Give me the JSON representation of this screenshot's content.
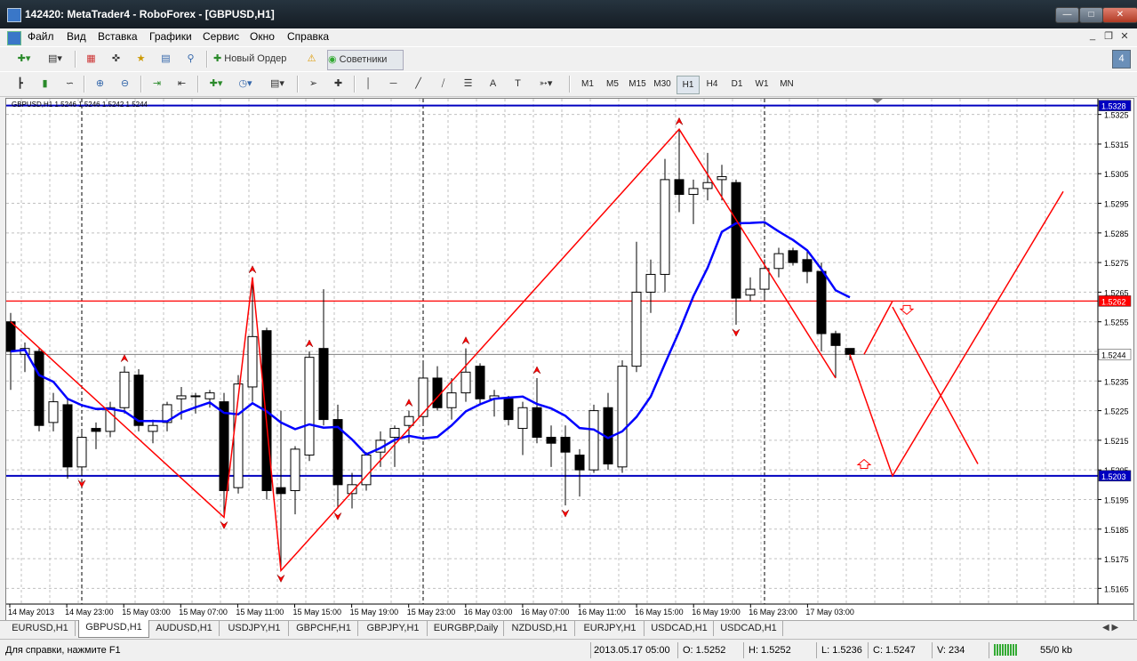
{
  "window": {
    "title": "142420: MetaTrader4 - RoboForex - [GBPUSD,H1]"
  },
  "menu": [
    "Файл",
    "Вид",
    "Вставка",
    "Графики",
    "Сервис",
    "Окно",
    "Справка"
  ],
  "toolbar": {
    "new_order": "Новый Ордер",
    "advisors": "Советники",
    "badge": "4"
  },
  "timeframes": [
    "M1",
    "M5",
    "M15",
    "M30",
    "H1",
    "H4",
    "D1",
    "W1",
    "MN"
  ],
  "active_timeframe": "H1",
  "chart": {
    "header": "GBPUSD,H1  1.5246 1.5246 1.5242 1.5244",
    "price_ticks": [
      "1.5325",
      "1.5315",
      "1.5305",
      "1.5295",
      "1.5285",
      "1.5275",
      "1.5265",
      "1.5255",
      "1.5235",
      "1.5225",
      "1.5215",
      "1.5205",
      "1.5195",
      "1.5185",
      "1.5175",
      "1.5165"
    ],
    "price_labels": {
      "top_line": "1.5328",
      "red_line": "1.5262",
      "current": "1.5244",
      "bottom_line": "1.5203"
    },
    "time_labels": [
      "14 May 2013",
      "14 May 23:00",
      "15 May 03:00",
      "15 May 07:00",
      "15 May 11:00",
      "15 May 15:00",
      "15 May 19:00",
      "15 May 23:00",
      "16 May 03:00",
      "16 May 07:00",
      "16 May 11:00",
      "16 May 15:00",
      "16 May 19:00",
      "16 May 23:00",
      "17 May 03:00"
    ],
    "colors": {
      "bg": "#ffffff",
      "grid": "#c0c0c0",
      "ma": "#0000ff",
      "zigzag": "#ff0000",
      "hline_blue": "#0000c0",
      "hline_red": "#ff0000",
      "bull": "#ffffff",
      "bear": "#000000"
    }
  },
  "chart_data": {
    "type": "candlestick",
    "symbol": "GBPUSD",
    "timeframe": "H1",
    "ylim": [
      1.516,
      1.533
    ],
    "candles": [
      {
        "o": 1.5255,
        "h": 1.5258,
        "l": 1.5232,
        "c": 1.5245
      },
      {
        "o": 1.5244,
        "h": 1.5248,
        "l": 1.5238,
        "c": 1.5246
      },
      {
        "o": 1.5245,
        "h": 1.5246,
        "l": 1.5218,
        "c": 1.522
      },
      {
        "o": 1.5221,
        "h": 1.5231,
        "l": 1.5218,
        "c": 1.5228
      },
      {
        "o": 1.5227,
        "h": 1.5229,
        "l": 1.5202,
        "c": 1.5206
      },
      {
        "o": 1.5206,
        "h": 1.5218,
        "l": 1.5203,
        "c": 1.5216
      },
      {
        "o": 1.5219,
        "h": 1.5221,
        "l": 1.5212,
        "c": 1.5218
      },
      {
        "o": 1.5218,
        "h": 1.5228,
        "l": 1.5216,
        "c": 1.5226
      },
      {
        "o": 1.5226,
        "h": 1.524,
        "l": 1.5224,
        "c": 1.5238
      },
      {
        "o": 1.5237,
        "h": 1.5239,
        "l": 1.5218,
        "c": 1.522
      },
      {
        "o": 1.5218,
        "h": 1.5222,
        "l": 1.5214,
        "c": 1.522
      },
      {
        "o": 1.5221,
        "h": 1.5228,
        "l": 1.5218,
        "c": 1.5227
      },
      {
        "o": 1.5229,
        "h": 1.5233,
        "l": 1.5222,
        "c": 1.523
      },
      {
        "o": 1.523,
        "h": 1.5231,
        "l": 1.5224,
        "c": 1.523
      },
      {
        "o": 1.5229,
        "h": 1.5232,
        "l": 1.5226,
        "c": 1.5231
      },
      {
        "o": 1.5228,
        "h": 1.5231,
        "l": 1.5189,
        "c": 1.5198
      },
      {
        "o": 1.5199,
        "h": 1.5237,
        "l": 1.5197,
        "c": 1.5234
      },
      {
        "o": 1.5233,
        "h": 1.527,
        "l": 1.5228,
        "c": 1.525
      },
      {
        "o": 1.5252,
        "h": 1.5253,
        "l": 1.5195,
        "c": 1.5198
      },
      {
        "o": 1.5199,
        "h": 1.5225,
        "l": 1.5171,
        "c": 1.5197
      },
      {
        "o": 1.5198,
        "h": 1.5213,
        "l": 1.519,
        "c": 1.5212
      },
      {
        "o": 1.521,
        "h": 1.5245,
        "l": 1.5208,
        "c": 1.5243
      },
      {
        "o": 1.5246,
        "h": 1.5266,
        "l": 1.522,
        "c": 1.5222
      },
      {
        "o": 1.5222,
        "h": 1.5227,
        "l": 1.5192,
        "c": 1.52
      },
      {
        "o": 1.5197,
        "h": 1.5204,
        "l": 1.5192,
        "c": 1.52
      },
      {
        "o": 1.52,
        "h": 1.5211,
        "l": 1.5198,
        "c": 1.521
      },
      {
        "o": 1.5211,
        "h": 1.5218,
        "l": 1.5206,
        "c": 1.5215
      },
      {
        "o": 1.5216,
        "h": 1.522,
        "l": 1.5206,
        "c": 1.5219
      },
      {
        "o": 1.522,
        "h": 1.5225,
        "l": 1.5214,
        "c": 1.5223
      },
      {
        "o": 1.5223,
        "h": 1.5241,
        "l": 1.522,
        "c": 1.5236
      },
      {
        "o": 1.5236,
        "h": 1.524,
        "l": 1.5225,
        "c": 1.5226
      },
      {
        "o": 1.5226,
        "h": 1.5236,
        "l": 1.5222,
        "c": 1.5231
      },
      {
        "o": 1.5231,
        "h": 1.5246,
        "l": 1.5228,
        "c": 1.5238
      },
      {
        "o": 1.524,
        "h": 1.5241,
        "l": 1.5227,
        "c": 1.5229
      },
      {
        "o": 1.5229,
        "h": 1.5232,
        "l": 1.5223,
        "c": 1.523
      },
      {
        "o": 1.5229,
        "h": 1.523,
        "l": 1.522,
        "c": 1.5222
      },
      {
        "o": 1.5219,
        "h": 1.5228,
        "l": 1.521,
        "c": 1.5226
      },
      {
        "o": 1.5226,
        "h": 1.5236,
        "l": 1.5214,
        "c": 1.5216
      },
      {
        "o": 1.5216,
        "h": 1.522,
        "l": 1.5206,
        "c": 1.5214
      },
      {
        "o": 1.5216,
        "h": 1.522,
        "l": 1.5193,
        "c": 1.5211
      },
      {
        "o": 1.521,
        "h": 1.5212,
        "l": 1.5196,
        "c": 1.5205
      },
      {
        "o": 1.5205,
        "h": 1.5227,
        "l": 1.5204,
        "c": 1.5225
      },
      {
        "o": 1.5226,
        "h": 1.5231,
        "l": 1.5205,
        "c": 1.5207
      },
      {
        "o": 1.5206,
        "h": 1.5242,
        "l": 1.5204,
        "c": 1.524
      },
      {
        "o": 1.524,
        "h": 1.5282,
        "l": 1.5238,
        "c": 1.5265
      },
      {
        "o": 1.5265,
        "h": 1.5276,
        "l": 1.5258,
        "c": 1.5271
      },
      {
        "o": 1.5271,
        "h": 1.531,
        "l": 1.5265,
        "c": 1.5303
      },
      {
        "o": 1.5303,
        "h": 1.532,
        "l": 1.5292,
        "c": 1.5298
      },
      {
        "o": 1.5298,
        "h": 1.5303,
        "l": 1.5288,
        "c": 1.53
      },
      {
        "o": 1.53,
        "h": 1.5312,
        "l": 1.5296,
        "c": 1.5302
      },
      {
        "o": 1.5303,
        "h": 1.5308,
        "l": 1.5296,
        "c": 1.5304
      },
      {
        "o": 1.5302,
        "h": 1.5303,
        "l": 1.5254,
        "c": 1.5263
      },
      {
        "o": 1.5264,
        "h": 1.527,
        "l": 1.5262,
        "c": 1.5266
      },
      {
        "o": 1.5266,
        "h": 1.5276,
        "l": 1.5263,
        "c": 1.5273
      },
      {
        "o": 1.5273,
        "h": 1.528,
        "l": 1.527,
        "c": 1.5278
      },
      {
        "o": 1.5279,
        "h": 1.528,
        "l": 1.5274,
        "c": 1.5275
      },
      {
        "o": 1.5276,
        "h": 1.5279,
        "l": 1.5268,
        "c": 1.5272
      },
      {
        "o": 1.5272,
        "h": 1.5275,
        "l": 1.5245,
        "c": 1.5251
      },
      {
        "o": 1.5251,
        "h": 1.5252,
        "l": 1.5236,
        "c": 1.5247
      },
      {
        "o": 1.5246,
        "h": 1.5246,
        "l": 1.5242,
        "c": 1.5244
      }
    ]
  },
  "tabs": [
    "EURUSD,H1",
    "GBPUSD,H1",
    "AUDUSD,H1",
    "USDJPY,H1",
    "GBPCHF,H1",
    "GBPJPY,H1",
    "EURGBP,Daily",
    "NZDUSD,H1",
    "EURJPY,H1",
    "USDCAD,H1",
    "USDCAD,H1"
  ],
  "active_tab": "GBPUSD,H1",
  "status": {
    "help": "Для справки, нажмите F1",
    "datetime": "2013.05.17 05:00",
    "open": "O: 1.5252",
    "high": "H: 1.5252",
    "low": "L: 1.5236",
    "close": "C: 1.5247",
    "volume": "V: 234",
    "traffic": "55/0 kb"
  }
}
